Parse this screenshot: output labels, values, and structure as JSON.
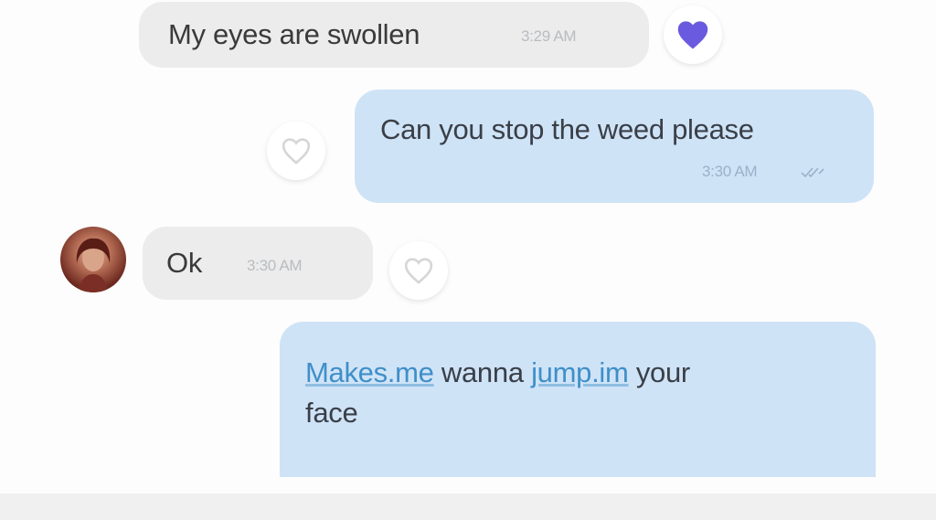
{
  "messages": [
    {
      "text": "My eyes are swollen",
      "time": "3:29 AM"
    },
    {
      "text": "Can you stop the weed please",
      "time": "3:30 AM"
    },
    {
      "text": "Ok",
      "time": "3:30 AM"
    },
    {
      "segments": [
        "Makes.me",
        " wanna ",
        "jump.im",
        " your",
        "face"
      ]
    }
  ],
  "icons": {
    "heart_filled": "heart-filled-icon",
    "heart_outline": "heart-outline-icon",
    "read_receipt": "double-check-icon",
    "avatar": "contact-avatar"
  },
  "colors": {
    "incoming_bubble": "#ececec",
    "outgoing_bubble": "#cfe3f7",
    "heart_filled": "#6a5ae0",
    "link": "#3f8fc8",
    "timestamp": "#b9bcc0"
  }
}
